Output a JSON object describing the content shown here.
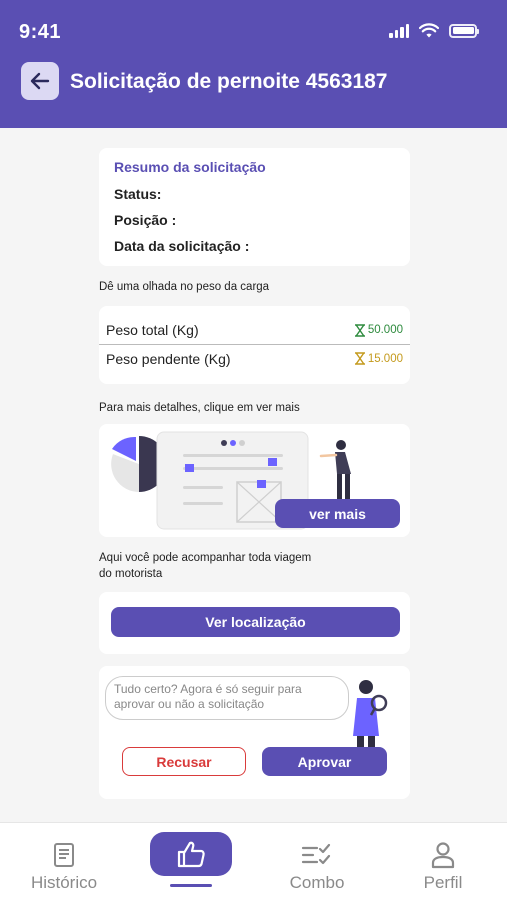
{
  "status_bar": {
    "time": "9:41"
  },
  "header": {
    "title": "Solicitação de pernoite 4563187"
  },
  "summary": {
    "title": "Resumo da solicitação",
    "status_label": "Status:",
    "position_label": "Posição :",
    "date_label": "Data da solicitação :"
  },
  "weights": {
    "section_label": "Dê uma olhada no peso da carga",
    "rows": [
      {
        "label": "Peso total (Kg)",
        "value": "50.000",
        "color": "#2e8b3e"
      },
      {
        "label": "Peso pendente (Kg)",
        "value": "15.000",
        "color": "#c49a1d"
      }
    ]
  },
  "details": {
    "section_label": "Para mais detalhes, clique em ver mais",
    "button_label": "ver mais"
  },
  "location": {
    "section_label_line1": "Aqui você pode acompanhar toda viagem",
    "section_label_line2": "do motorista",
    "button_label": "Ver localização"
  },
  "approval": {
    "message": "Tudo certo? Agora é só seguir para aprovar ou não a solicitação",
    "reject_label": "Recusar",
    "approve_label": "Aprovar"
  },
  "nav": {
    "items": [
      {
        "label": "Histórico",
        "icon": "document-icon"
      },
      {
        "label": "",
        "icon": "thumbs-up-icon",
        "active": true
      },
      {
        "label": "Combo",
        "icon": "checklist-icon"
      },
      {
        "label": "Perfil",
        "icon": "user-icon"
      }
    ]
  },
  "colors": {
    "primary": "#5a4fb3",
    "danger": "#d93b3b",
    "success": "#2e8b3e",
    "warning": "#c49a1d"
  }
}
